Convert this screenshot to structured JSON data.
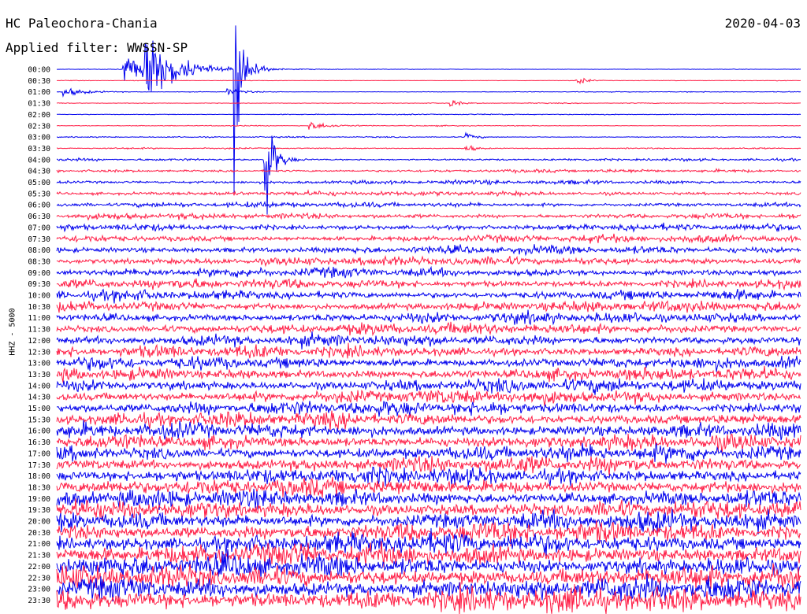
{
  "header": {
    "station": "HC Paleochora-Chania",
    "date": "2020-04-03",
    "filter_label": "Applied filter: WWSSN-SP"
  },
  "axis": {
    "channel_label": "HHZ - 5000"
  },
  "colors": {
    "even_trace": "#0000ee",
    "odd_trace": "#ff1e46",
    "text": "#000000",
    "background": "#ffffff"
  },
  "chart_data": {
    "type": "line",
    "title": "HC Paleochora-Chania",
    "subtitle": "Applied filter: WWSSN-SP",
    "ylabel": "HHZ - 5000",
    "categories": [
      "00:00",
      "00:30",
      "01:00",
      "01:30",
      "02:00",
      "02:30",
      "03:00",
      "03:30",
      "04:00",
      "04:30",
      "05:00",
      "05:30",
      "06:00",
      "06:30",
      "07:00",
      "07:30",
      "08:00",
      "08:30",
      "09:00",
      "09:30",
      "10:00",
      "10:30",
      "11:00",
      "11:30",
      "12:00",
      "12:30",
      "13:00",
      "13:30",
      "14:00",
      "14:30",
      "15:00",
      "15:30",
      "16:00",
      "16:30",
      "17:00",
      "17:30",
      "18:00",
      "18:30",
      "19:00",
      "19:30",
      "20:00",
      "20:30",
      "21:00",
      "21:30",
      "22:00",
      "22:30",
      "23:00",
      "23:30"
    ],
    "noise_level": [
      0.3,
      0.3,
      0.4,
      0.4,
      0.5,
      0.5,
      0.6,
      0.7,
      1.2,
      1.6,
      2.0,
      2.3,
      2.6,
      3.0,
      3.4,
      3.8,
      4.0,
      4.3,
      4.6,
      4.8,
      5.0,
      5.2,
      5.4,
      5.6,
      5.8,
      6.0,
      6.2,
      6.4,
      6.6,
      6.8,
      7.0,
      7.2,
      7.4,
      7.6,
      7.8,
      8.0,
      8.2,
      8.4,
      8.8,
      9.2,
      9.6,
      10.0,
      10.4,
      10.8,
      11.2,
      11.6,
      12.0,
      12.4
    ],
    "events": [
      {
        "row": 0,
        "t": 0.09,
        "amplitude": 14,
        "duration": 0.05
      },
      {
        "row": 0,
        "t": 0.12,
        "amplitude": 40,
        "duration": 0.03
      },
      {
        "row": 0,
        "t": 0.24,
        "amplitude": 120,
        "duration": 0.01
      },
      {
        "row": 1,
        "t": 0.7,
        "amplitude": 6,
        "duration": 0.01
      },
      {
        "row": 2,
        "t": 0.01,
        "amplitude": 6,
        "duration": 0.02
      },
      {
        "row": 2,
        "t": 0.23,
        "amplitude": 4,
        "duration": 0.02
      },
      {
        "row": 3,
        "t": 0.53,
        "amplitude": 5,
        "duration": 0.01
      },
      {
        "row": 5,
        "t": 0.34,
        "amplitude": 5,
        "duration": 0.02
      },
      {
        "row": 6,
        "t": 0.55,
        "amplitude": 6,
        "duration": 0.01
      },
      {
        "row": 7,
        "t": 0.55,
        "amplitude": 6,
        "duration": 0.01
      },
      {
        "row": 8,
        "t": 0.28,
        "amplitude": 80,
        "duration": 0.01
      }
    ]
  }
}
